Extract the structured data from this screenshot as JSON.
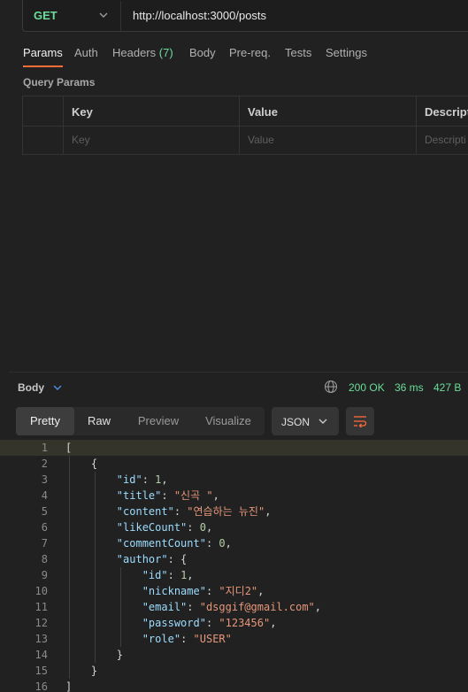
{
  "request": {
    "method": "GET",
    "url": "http://localhost:3000/posts",
    "tabs": [
      {
        "label": "Params",
        "count": ""
      },
      {
        "label": "Auth",
        "count": ""
      },
      {
        "label": "Headers",
        "count": "(7)"
      },
      {
        "label": "Body",
        "count": ""
      },
      {
        "label": "Pre-req.",
        "count": ""
      },
      {
        "label": "Tests",
        "count": ""
      },
      {
        "label": "Settings",
        "count": ""
      }
    ],
    "query_params_label": "Query Params",
    "table": {
      "headers": [
        "Key",
        "Value",
        "Descripti"
      ],
      "placeholders": [
        "Key",
        "Value",
        "Descripti"
      ]
    }
  },
  "response": {
    "label": "Body",
    "status": "200 OK",
    "time": "36 ms",
    "size": "427 B",
    "view_tabs": [
      "Pretty",
      "Raw",
      "Preview",
      "Visualize"
    ],
    "format": "JSON",
    "lines": [
      [
        [
          "p",
          "["
        ]
      ],
      [
        [
          "p",
          "    {"
        ]
      ],
      [
        [
          "p",
          "        "
        ],
        [
          "k",
          "\"id\""
        ],
        [
          "p",
          ": "
        ],
        [
          "n",
          "1"
        ],
        [
          "p",
          ","
        ]
      ],
      [
        [
          "p",
          "        "
        ],
        [
          "k",
          "\"title\""
        ],
        [
          "p",
          ": "
        ],
        [
          "s",
          "\"신곡 \""
        ],
        [
          "p",
          ","
        ]
      ],
      [
        [
          "p",
          "        "
        ],
        [
          "k",
          "\"content\""
        ],
        [
          "p",
          ": "
        ],
        [
          "s",
          "\"연습하는 뉴진\""
        ],
        [
          "p",
          ","
        ]
      ],
      [
        [
          "p",
          "        "
        ],
        [
          "k",
          "\"likeCount\""
        ],
        [
          "p",
          ": "
        ],
        [
          "n",
          "0"
        ],
        [
          "p",
          ","
        ]
      ],
      [
        [
          "p",
          "        "
        ],
        [
          "k",
          "\"commentCount\""
        ],
        [
          "p",
          ": "
        ],
        [
          "n",
          "0"
        ],
        [
          "p",
          ","
        ]
      ],
      [
        [
          "p",
          "        "
        ],
        [
          "k",
          "\"author\""
        ],
        [
          "p",
          ": {"
        ]
      ],
      [
        [
          "p",
          "            "
        ],
        [
          "k",
          "\"id\""
        ],
        [
          "p",
          ": "
        ],
        [
          "n",
          "1"
        ],
        [
          "p",
          ","
        ]
      ],
      [
        [
          "p",
          "            "
        ],
        [
          "k",
          "\"nickname\""
        ],
        [
          "p",
          ": "
        ],
        [
          "s",
          "\"지디2\""
        ],
        [
          "p",
          ","
        ]
      ],
      [
        [
          "p",
          "            "
        ],
        [
          "k",
          "\"email\""
        ],
        [
          "p",
          ": "
        ],
        [
          "s",
          "\"dsggif@gmail.com\""
        ],
        [
          "p",
          ","
        ]
      ],
      [
        [
          "p",
          "            "
        ],
        [
          "k",
          "\"password\""
        ],
        [
          "p",
          ": "
        ],
        [
          "s",
          "\"123456\""
        ],
        [
          "p",
          ","
        ]
      ],
      [
        [
          "p",
          "            "
        ],
        [
          "k",
          "\"role\""
        ],
        [
          "p",
          ": "
        ],
        [
          "s",
          "\"USER\""
        ]
      ],
      [
        [
          "p",
          "        }"
        ]
      ],
      [
        [
          "p",
          "    }"
        ]
      ],
      [
        [
          "p",
          "]"
        ]
      ]
    ]
  }
}
